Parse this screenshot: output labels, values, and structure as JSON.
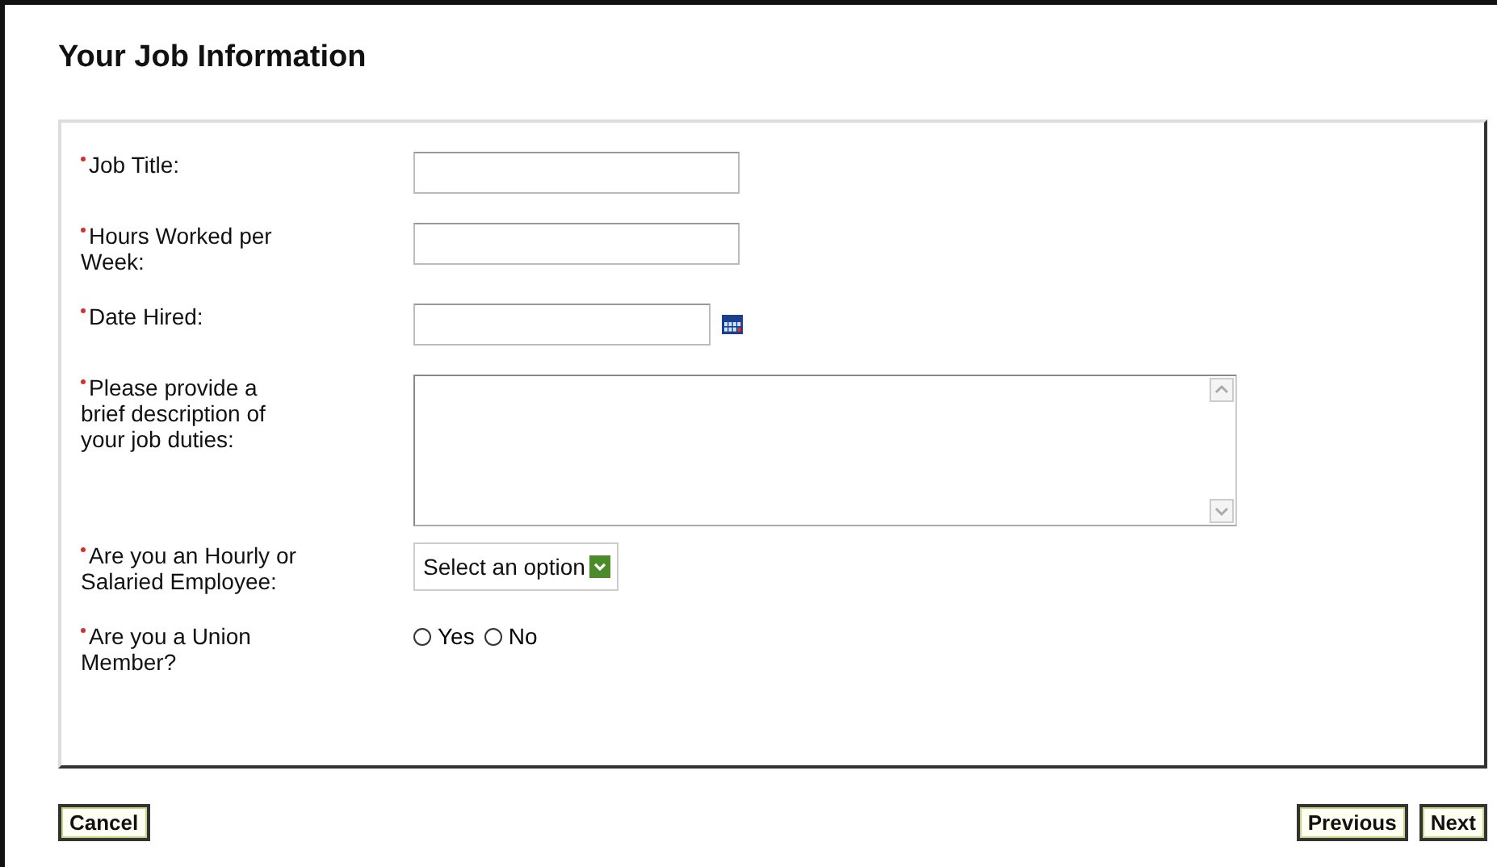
{
  "title": "Your Job Information",
  "fields": [
    {
      "kind": "text",
      "label": "Job Title:",
      "required": true
    },
    {
      "kind": "text",
      "label": "Hours Worked per Week:",
      "required": true
    },
    {
      "kind": "date",
      "label": "Date Hired:",
      "required": true
    },
    {
      "kind": "textarea",
      "label": "Please provide a brief description of your job duties:",
      "required": true
    },
    {
      "kind": "select",
      "label": "Are you an Hourly or Salaried Employee:",
      "required": true,
      "value": "Select an option"
    },
    {
      "kind": "radio",
      "label": "Are you a Union Member?",
      "required": true,
      "options": [
        {
          "label": "Yes",
          "selected": false
        },
        {
          "label": "No",
          "selected": false
        }
      ]
    }
  ],
  "buttons_left": [
    "Cancel"
  ],
  "buttons_right": [
    "Previous",
    "Next"
  ]
}
